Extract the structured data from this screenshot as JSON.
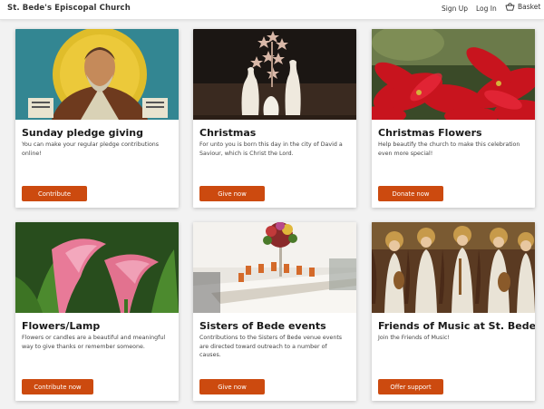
{
  "header": {
    "brand": "St. Bede's Episcopal Church",
    "signup": "Sign Up",
    "login": "Log In",
    "basket": "Basket",
    "basket_icon": "basket-icon"
  },
  "cards": [
    {
      "title": "Sunday pledge giving",
      "description": "You can make your regular pledge contributions online!",
      "button": "Contribute",
      "image": "icon-of-saint-image"
    },
    {
      "title": "Christmas",
      "description": "For unto you is born this day in the city of David a Saviour, which is Christ the Lord.",
      "button": "Give now",
      "image": "nativity-figurines-image"
    },
    {
      "title": "Christmas Flowers",
      "description": "Help beautify the church to make this celebration even more special!",
      "button": "Donate now",
      "image": "poinsettia-image"
    },
    {
      "title": "Flowers/Lamp",
      "description": "Flowers or candles are a beautiful and meaningful way to give thanks or remember someone.",
      "button": "Contribute now",
      "image": "calla-lily-image"
    },
    {
      "title": "Sisters of Bede events",
      "description": "Contributions to the Sisters of Bede venue events are directed toward outreach to a number of causes.",
      "button": "Give now",
      "image": "banquet-table-image"
    },
    {
      "title": "Friends of Music at St. Bede's",
      "description": "Join the Friends of Music!",
      "button": "Offer support",
      "image": "musician-angels-image"
    }
  ],
  "colors": {
    "button": "#cc4a0f",
    "background": "#f2f2f2"
  }
}
